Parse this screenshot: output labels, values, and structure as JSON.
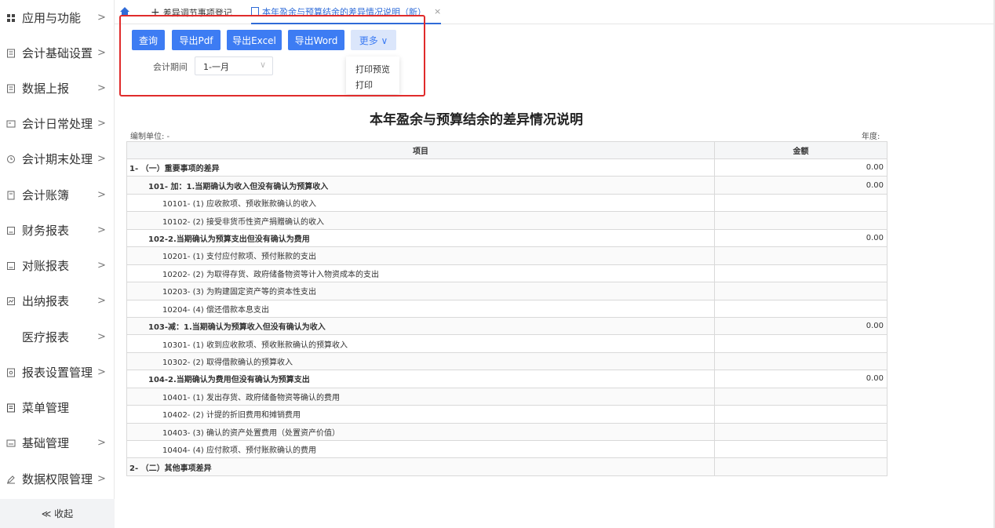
{
  "sidebar": {
    "items": [
      {
        "label": "应用与功能",
        "icon": "grid-icon",
        "chevron": ">"
      },
      {
        "label": "会计基础设置",
        "icon": "doc-icon",
        "chevron": ">"
      },
      {
        "label": "数据上报",
        "icon": "doc-icon",
        "chevron": ">"
      },
      {
        "label": "会计日常处理",
        "icon": "card-icon",
        "chevron": ">"
      },
      {
        "label": "会计期末处理",
        "icon": "clock-icon",
        "chevron": ">"
      },
      {
        "label": "会计账簿",
        "icon": "book-icon",
        "chevron": ">"
      },
      {
        "label": "财务报表",
        "icon": "report-icon",
        "chevron": ">"
      },
      {
        "label": "对账报表",
        "icon": "report-icon",
        "chevron": ">"
      },
      {
        "label": "出纳报表",
        "icon": "chart-icon",
        "chevron": ">"
      },
      {
        "label": "医疗报表",
        "icon": "",
        "chevron": ">"
      },
      {
        "label": "报表设置管理",
        "icon": "settings-doc-icon",
        "chevron": ">"
      },
      {
        "label": "菜单管理",
        "icon": "menu-icon",
        "chevron": ""
      },
      {
        "label": "基础管理",
        "icon": "id-card-icon",
        "chevron": ">"
      },
      {
        "label": "数据权限管理",
        "icon": "pen-icon",
        "chevron": ">"
      }
    ],
    "collapse_label": "≪ 收起"
  },
  "tabs": {
    "items": [
      {
        "label": "差异调节事项登记",
        "close": ""
      },
      {
        "label": "本年盈余与预算结余的差异情况说明（新）",
        "close": "×"
      }
    ]
  },
  "toolbar": {
    "query": "查询",
    "export_pdf": "导出Pdf",
    "export_excel": "导出Excel",
    "export_word": "导出Word",
    "more": "更多 ∨",
    "period_label": "会计期间",
    "period_value": "1-一月",
    "more_menu": [
      "打印预览",
      "打印"
    ]
  },
  "report": {
    "title": "本年盈余与预算结余的差异情况说明",
    "unit_label": "编制单位: -",
    "year_label": "年度:",
    "columns": [
      "项目",
      "金额"
    ],
    "rows": [
      {
        "item": "1- （一）重要事项的差异",
        "amount": "0.00",
        "level": 0
      },
      {
        "item": "101- 加：1.当期确认为收入但没有确认为预算收入",
        "amount": "0.00",
        "level": 1
      },
      {
        "item": "10101- (1) 应收款项、预收账款确认的收入",
        "amount": "",
        "level": 2
      },
      {
        "item": "10102- (2) 接受非货币性资产捐赠确认的收入",
        "amount": "",
        "level": 2
      },
      {
        "item": "102-2.当期确认为预算支出但没有确认为费用",
        "amount": "0.00",
        "level": 1
      },
      {
        "item": "10201- (1) 支付应付款项、预付账款的支出",
        "amount": "",
        "level": 2
      },
      {
        "item": "10202- (2) 为取得存货、政府储备物资等计入物资成本的支出",
        "amount": "",
        "level": 2
      },
      {
        "item": "10203- (3) 为购建固定资产等的资本性支出",
        "amount": "",
        "level": 2
      },
      {
        "item": "10204- (4) 偿还借款本息支出",
        "amount": "",
        "level": 2
      },
      {
        "item": "103-减：1.当期确认为预算收入但没有确认为收入",
        "amount": "0.00",
        "level": 1
      },
      {
        "item": "10301- (1) 收到应收款项、预收账款确认的预算收入",
        "amount": "",
        "level": 2
      },
      {
        "item": "10302- (2) 取得借款确认的预算收入",
        "amount": "",
        "level": 2
      },
      {
        "item": "104-2.当期确认为费用但没有确认为预算支出",
        "amount": "0.00",
        "level": 1
      },
      {
        "item": "10401- (1) 发出存货、政府储备物资等确认的费用",
        "amount": "",
        "level": 2
      },
      {
        "item": "10402- (2) 计提的折旧费用和摊销费用",
        "amount": "",
        "level": 2
      },
      {
        "item": "10403- (3) 确认的资产处置费用（处置资产价值）",
        "amount": "",
        "level": 2
      },
      {
        "item": "10404- (4) 应付款项、预付账款确认的费用",
        "amount": "",
        "level": 2
      },
      {
        "item": "2- （二）其他事项差异",
        "amount": "",
        "level": 0
      }
    ]
  },
  "colors": {
    "primary": "#3d7cf3",
    "highlight_border": "#e02b2b",
    "tab_active": "#2f6bd8"
  }
}
